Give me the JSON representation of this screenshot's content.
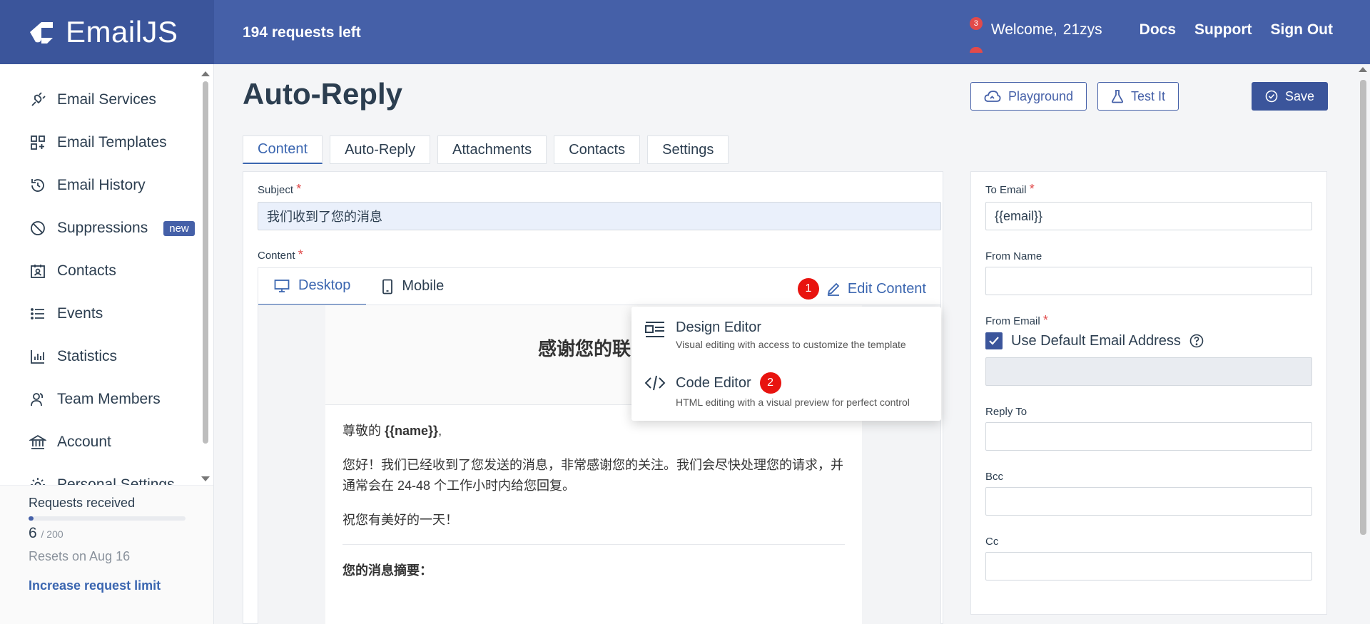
{
  "header": {
    "brand": "EmailJS",
    "requests_left": "194 requests left",
    "notification_count": "3",
    "welcome_label": "Welcome,",
    "username": "21zys",
    "links": [
      "Docs",
      "Support",
      "Sign Out"
    ]
  },
  "sidebar": {
    "items": [
      {
        "label": "Email Services",
        "icon": "plug-icon"
      },
      {
        "label": "Email Templates",
        "icon": "templates-icon"
      },
      {
        "label": "Email History",
        "icon": "history-icon"
      },
      {
        "label": "Suppressions",
        "icon": "ban-icon",
        "badge": "new"
      },
      {
        "label": "Contacts",
        "icon": "contact-card-icon"
      },
      {
        "label": "Events",
        "icon": "list-icon"
      },
      {
        "label": "Statistics",
        "icon": "bar-chart-icon"
      },
      {
        "label": "Team Members",
        "icon": "team-icon"
      },
      {
        "label": "Account",
        "icon": "bank-icon"
      },
      {
        "label": "Personal Settings",
        "icon": "gear-icon"
      }
    ],
    "usage": {
      "label": "Requests received",
      "count": "6",
      "total": "/ 200",
      "fraction": 0.03,
      "reset": "Resets on Aug 16",
      "link": "Increase request limit"
    }
  },
  "main": {
    "title": "Auto-Reply",
    "buttons": {
      "playground": "Playground",
      "test": "Test It",
      "save": "Save"
    },
    "tabs": [
      "Content",
      "Auto-Reply",
      "Attachments",
      "Contacts",
      "Settings"
    ],
    "subject_label": "Subject",
    "subject_value": "我们收到了您的消息",
    "content_label": "Content",
    "editor_tabs": [
      "Desktop",
      "Mobile"
    ],
    "edit_content": "Edit Content",
    "markers": [
      "1",
      "2"
    ],
    "dropdown": {
      "design_title": "Design Editor",
      "design_desc": "Visual editing with access to customize the template",
      "code_title": "Code Editor",
      "code_desc": "HTML editing with a visual preview for perfect control"
    },
    "preview": {
      "heading": "感谢您的联系",
      "greeting_prefix": "尊敬的 ",
      "greeting_name": "{{name}}",
      "greeting_suffix": ",",
      "para1": "您好！我们已经收到了您发送的消息，非常感谢您的关注。我们会尽快处理您的请求，并通常会在 24-48 个工作小时内给您回复。",
      "para2": "祝您有美好的一天！",
      "summary_title": "您的消息摘要："
    }
  },
  "right_panel": {
    "to_email_label": "To Email",
    "to_email_value": "{{email}}",
    "from_name_label": "From Name",
    "from_email_label": "From Email",
    "default_email_label": "Use Default Email Address",
    "reply_to_label": "Reply To",
    "bcc_label": "Bcc",
    "cc_label": "Cc"
  },
  "colors": {
    "header": "#4560a8",
    "brand_bg": "#3b559b",
    "accent": "#3b66b0",
    "marker": "#e8130f"
  }
}
